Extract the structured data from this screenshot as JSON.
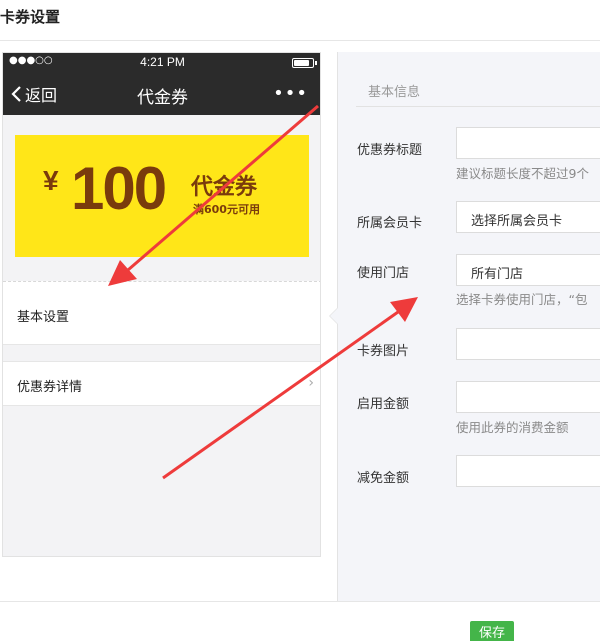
{
  "page": {
    "title": "卡券设置"
  },
  "phone": {
    "status": {
      "signal": "●●●○○",
      "time": "4:21 PM"
    },
    "nav": {
      "back_label": "返回",
      "title": "代金券",
      "more_label": "•••"
    },
    "coupon": {
      "currency": "¥",
      "amount": "100",
      "type": "代金券",
      "condition": "满600元可用",
      "background": "#ffe618",
      "text_color": "#7a3b0c"
    },
    "menu": {
      "basic_settings": "基本设置",
      "coupon_details": "优惠券详情"
    }
  },
  "panel": {
    "section_title": "基本信息",
    "fields": {
      "coupon_title": {
        "label": "优惠券标题",
        "value": "",
        "hint": "建议标题长度不超过9个"
      },
      "member_card": {
        "label": "所属会员卡",
        "value": "选择所属会员卡"
      },
      "store": {
        "label": "使用门店",
        "value": "所有门店",
        "hint": "选择卡券使用门店，“包"
      },
      "card_image": {
        "label": "卡券图片",
        "value": ""
      },
      "enable_amount": {
        "label": "启用金额",
        "value": "",
        "hint": "使用此券的消费金额"
      },
      "discount_amount": {
        "label": "减免金额",
        "value": ""
      }
    }
  },
  "footer": {
    "save_label": "保存"
  },
  "colors": {
    "accent_green": "#44b549",
    "annotation_red": "#ee3b3b",
    "dark_bar": "#2b2b2b"
  },
  "battery_level": 0.85
}
